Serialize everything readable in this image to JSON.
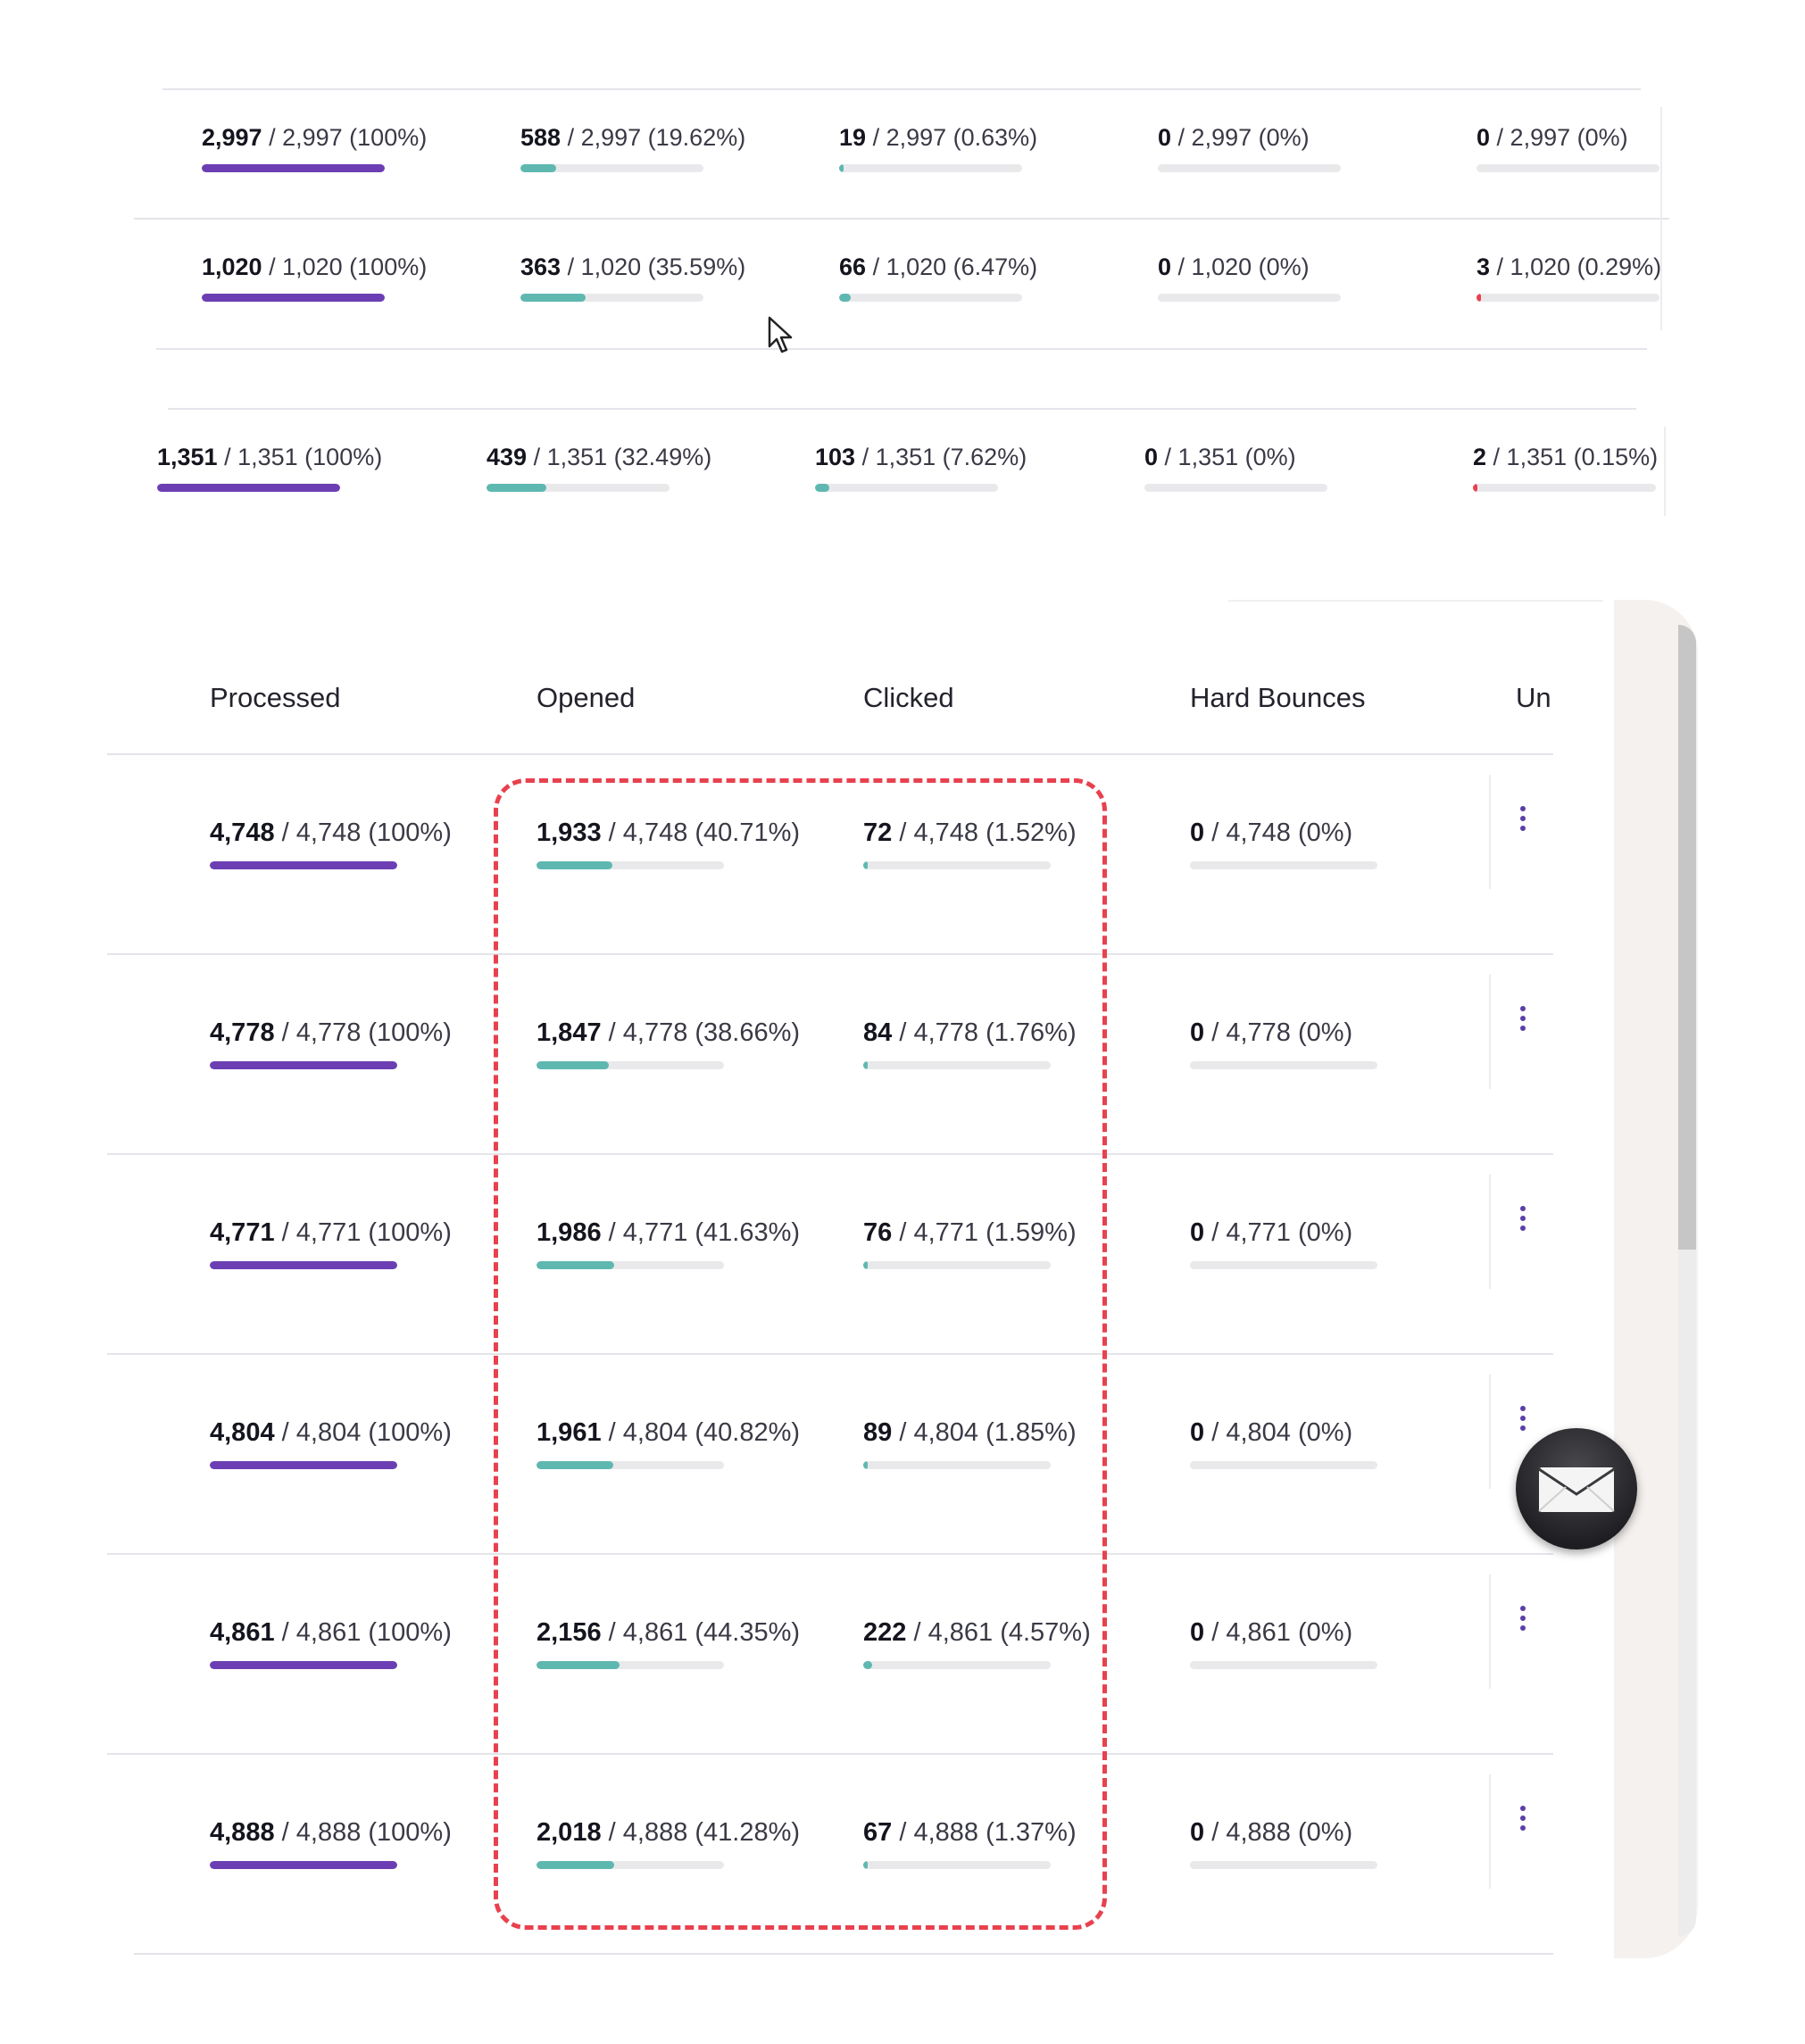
{
  "colors": {
    "processed_bar": "#6b3fb3",
    "opened_bar": "#5fb8b0",
    "clicked_bar": "#5fb8b0",
    "red_bar": "#e8414e",
    "track": "#e9e9ec",
    "highlight": "#e8414e"
  },
  "icons": {
    "row_menu": "kebab-vertical-icon",
    "chat": "envelope-icon",
    "pointer": "mouse-cursor-icon"
  },
  "top_rows": [
    [
      {
        "value": "2,997",
        "detail": "/ 2,997 (100%)",
        "pct": 100,
        "color": "processed_bar"
      },
      {
        "value": "588",
        "detail": "/ 2,997 (19.62%)",
        "pct": 19.62,
        "color": "opened_bar"
      },
      {
        "value": "19",
        "detail": "/ 2,997 (0.63%)",
        "pct": 0.63,
        "color": "clicked_bar"
      },
      {
        "value": "0",
        "detail": "/ 2,997 (0%)",
        "pct": 0,
        "color": "clicked_bar"
      },
      {
        "value": "0",
        "detail": "/ 2,997 (0%)",
        "pct": 0,
        "color": "red_bar"
      }
    ],
    [
      {
        "value": "1,020",
        "detail": "/ 1,020 (100%)",
        "pct": 100,
        "color": "processed_bar"
      },
      {
        "value": "363",
        "detail": "/ 1,020 (35.59%)",
        "pct": 35.59,
        "color": "opened_bar"
      },
      {
        "value": "66",
        "detail": "/ 1,020 (6.47%)",
        "pct": 6.47,
        "color": "clicked_bar"
      },
      {
        "value": "0",
        "detail": "/ 1,020 (0%)",
        "pct": 0,
        "color": "clicked_bar"
      },
      {
        "value": "3",
        "detail": "/ 1,020 (0.29%)",
        "pct": 0.29,
        "color": "red_bar"
      }
    ],
    [
      {
        "value": "1,351",
        "detail": "/ 1,351 (100%)",
        "pct": 100,
        "color": "processed_bar"
      },
      {
        "value": "439",
        "detail": "/ 1,351 (32.49%)",
        "pct": 32.49,
        "color": "opened_bar"
      },
      {
        "value": "103",
        "detail": "/ 1,351 (7.62%)",
        "pct": 7.62,
        "color": "clicked_bar"
      },
      {
        "value": "0",
        "detail": "/ 1,351 (0%)",
        "pct": 0,
        "color": "clicked_bar"
      },
      {
        "value": "2",
        "detail": "/ 1,351 (0.15%)",
        "pct": 0.15,
        "color": "red_bar"
      }
    ]
  ],
  "table": {
    "headers": [
      "Processed",
      "Opened",
      "Clicked",
      "Hard Bounces",
      "Un"
    ],
    "rows": [
      [
        {
          "value": "4,748",
          "detail": "/ 4,748 (100%)",
          "pct": 100,
          "color": "processed_bar"
        },
        {
          "value": "1,933",
          "detail": "/ 4,748 (40.71%)",
          "pct": 40.71,
          "color": "opened_bar"
        },
        {
          "value": "72",
          "detail": "/ 4,748 (1.52%)",
          "pct": 1.52,
          "color": "clicked_bar"
        },
        {
          "value": "0",
          "detail": "/ 4,748 (0%)",
          "pct": 0,
          "color": "clicked_bar"
        }
      ],
      [
        {
          "value": "4,778",
          "detail": "/ 4,778 (100%)",
          "pct": 100,
          "color": "processed_bar"
        },
        {
          "value": "1,847",
          "detail": "/ 4,778 (38.66%)",
          "pct": 38.66,
          "color": "opened_bar"
        },
        {
          "value": "84",
          "detail": "/ 4,778 (1.76%)",
          "pct": 1.76,
          "color": "clicked_bar"
        },
        {
          "value": "0",
          "detail": "/ 4,778 (0%)",
          "pct": 0,
          "color": "clicked_bar"
        }
      ],
      [
        {
          "value": "4,771",
          "detail": "/ 4,771 (100%)",
          "pct": 100,
          "color": "processed_bar"
        },
        {
          "value": "1,986",
          "detail": "/ 4,771 (41.63%)",
          "pct": 41.63,
          "color": "opened_bar"
        },
        {
          "value": "76",
          "detail": "/ 4,771 (1.59%)",
          "pct": 1.59,
          "color": "clicked_bar"
        },
        {
          "value": "0",
          "detail": "/ 4,771 (0%)",
          "pct": 0,
          "color": "clicked_bar"
        }
      ],
      [
        {
          "value": "4,804",
          "detail": "/ 4,804 (100%)",
          "pct": 100,
          "color": "processed_bar"
        },
        {
          "value": "1,961",
          "detail": "/ 4,804 (40.82%)",
          "pct": 40.82,
          "color": "opened_bar"
        },
        {
          "value": "89",
          "detail": "/ 4,804 (1.85%)",
          "pct": 1.85,
          "color": "clicked_bar"
        },
        {
          "value": "0",
          "detail": "/ 4,804 (0%)",
          "pct": 0,
          "color": "clicked_bar"
        }
      ],
      [
        {
          "value": "4,861",
          "detail": "/ 4,861 (100%)",
          "pct": 100,
          "color": "processed_bar"
        },
        {
          "value": "2,156",
          "detail": "/ 4,861 (44.35%)",
          "pct": 44.35,
          "color": "opened_bar"
        },
        {
          "value": "222",
          "detail": "/ 4,861 (4.57%)",
          "pct": 4.57,
          "color": "clicked_bar"
        },
        {
          "value": "0",
          "detail": "/ 4,861 (0%)",
          "pct": 0,
          "color": "clicked_bar"
        }
      ],
      [
        {
          "value": "4,888",
          "detail": "/ 4,888 (100%)",
          "pct": 100,
          "color": "processed_bar"
        },
        {
          "value": "2,018",
          "detail": "/ 4,888 (41.28%)",
          "pct": 41.28,
          "color": "opened_bar"
        },
        {
          "value": "67",
          "detail": "/ 4,888 (1.37%)",
          "pct": 1.37,
          "color": "clicked_bar"
        },
        {
          "value": "0",
          "detail": "/ 4,888 (0%)",
          "pct": 0,
          "color": "clicked_bar"
        }
      ]
    ]
  }
}
